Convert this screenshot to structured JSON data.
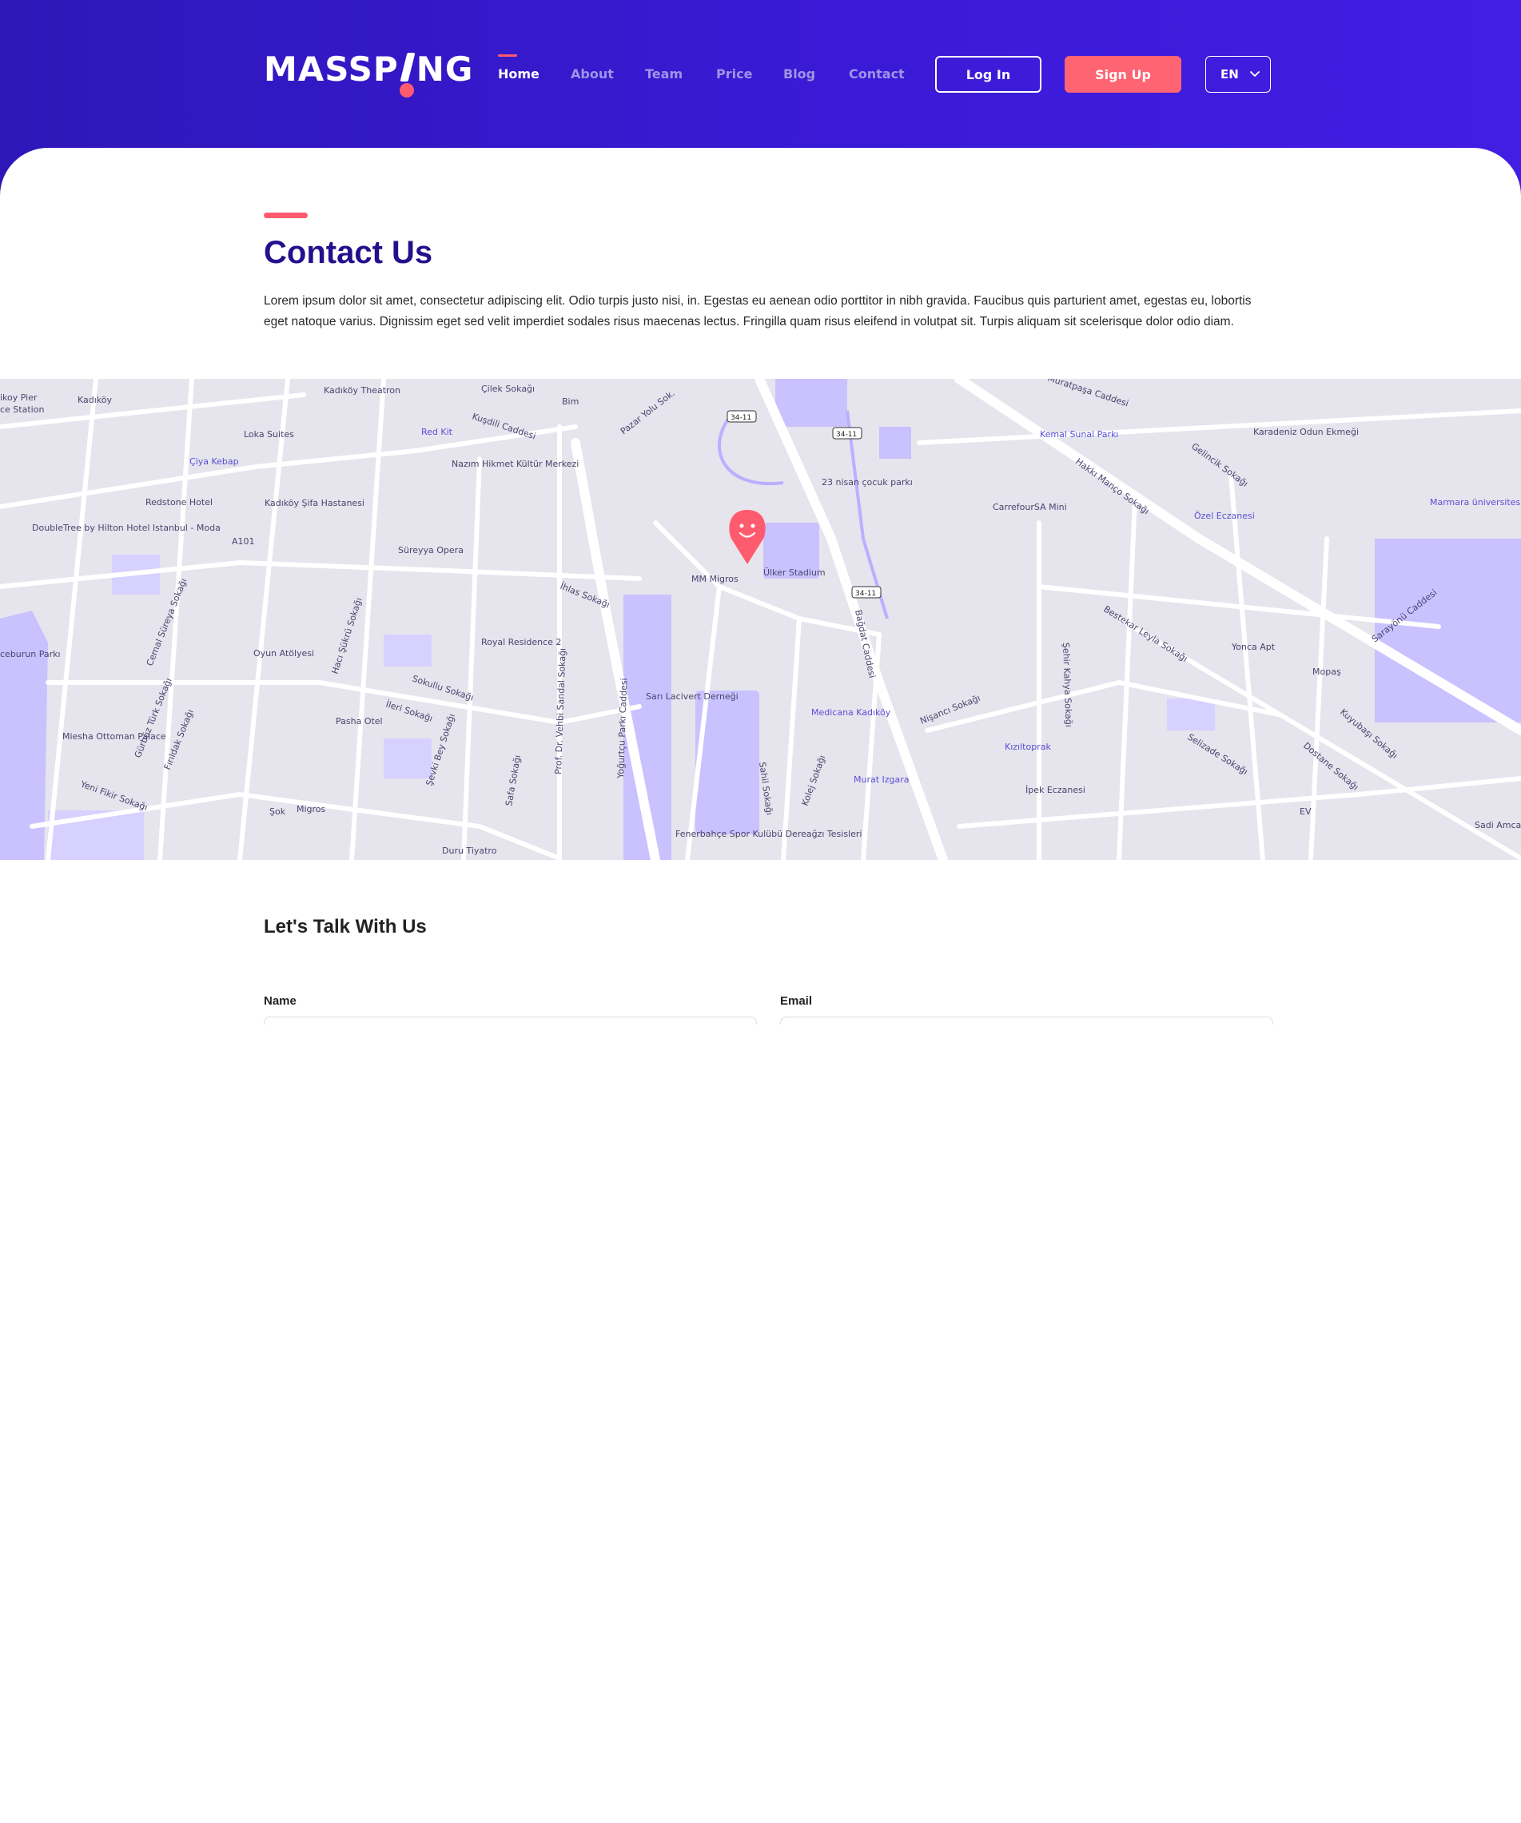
{
  "header": {
    "logo_text_left": "MASSP",
    "logo_text_right": "NG",
    "nav": [
      "Home",
      "About",
      "Team",
      "Price",
      "Blog",
      "Contact"
    ],
    "active_nav": "Home",
    "login_label": "Log In",
    "signup_label": "Sign Up",
    "language": "EN"
  },
  "page": {
    "title": "Contact Us",
    "intro": "Lorem ipsum dolor sit amet, consectetur adipiscing elit. Odio turpis justo nisi, in. Egestas eu aenean odio porttitor in nibh gravida. Faucibus quis parturient amet, egestas eu, lobortis eget natoque varius. Dignissim eget sed velit imperdiet sodales risus maecenas lectus. Fringilla quam risus eleifend in volutpat sit. Turpis aliquam sit scelerisque dolor odio diam."
  },
  "map": {
    "labels": {
      "ulker_stadium": "Ülker Stadium",
      "mm_migros": "MM Migros",
      "bagdat_caddesi": "Bağdat Caddesi",
      "kusdili_caddesi": "Kuşdili Caddesi",
      "kadikoy_theatron": "Kadıköy Theatron",
      "cilek_sokagi": "Çilek Sokağı",
      "bim": "Bim",
      "pazar_yolu": "Pazar Yolu Sok.",
      "red_kit": "Red Kit",
      "nazim_hikmet": "Nazım Hikmet Kültür Merkezi",
      "loka_suites": "Loka Suites",
      "ciya_kebap": "Çiya Kebap",
      "redstone_hotel": "Redstone Hotel",
      "kadikoy_sifa": "Kadıköy Şifa Hastanesi",
      "doubletree": "DoubleTree by Hilton Hotel Istanbul - Moda",
      "a101": "A101",
      "sureyya_opera": "Süreyya Opera",
      "ihlas_sokagi": "İhlas Sokağı",
      "royal_residence": "Royal Residence 2",
      "oyun_atolyesi": "Oyun Atölyesi",
      "sokullu_sokagi": "Sokullu Sokağı",
      "ileri_sokagi": "İleri Sokağı",
      "pasha_otel": "Pasha Otel",
      "sari_lacivert": "Sarı Lacivert Derneği",
      "medicana": "Medicana Kadıköy",
      "nisanci_sokagi": "Nişancı Sokağı",
      "kiziltoprak": "Kızıltoprak",
      "ipek_eczanesi": "İpek Eczanesi",
      "murat_izgara": "Murat Izgara",
      "fenerbahce_tesis": "Fenerbahçe Spor Kulübü Dereağzı Tesisleri",
      "sok": "Şok",
      "migros": "Migros",
      "duru_tiyatro": "Duru Tiyatro",
      "miesha_palace": "Miesha Ottoman Palace",
      "yeni_fikir": "Yeni Fikir Sokağı",
      "kemal_sunal": "Kemal Sunal Parkı",
      "karadeniz_ekmek": "Karadeniz Odun Ekmeği",
      "carrefour": "CarrefourSA Mini",
      "ozel_eczanesi": "Özel Eczanesi",
      "marmara_uni": "Marmara üniversitesi",
      "yonca_apt": "Yonca Apt",
      "mopas": "Mopaş",
      "sadi_amca": "Sadi Amca",
      "ev": "EV",
      "cocuk_parki": "23 nisan çocuk parkı",
      "road_3411": "34-11",
      "bestekar": "Bestekar Leyla Sokağı",
      "selizade": "Selizade Sokağı",
      "kuyubasi": "Kuyubaşı Sokağı",
      "dostane": "Dostane Sokağı",
      "sarayonu": "Sarayönü Caddesi",
      "hakki_manco": "Hakkı Manço Sokağı",
      "gelincik": "Gelincik Sokağı",
      "muratpasa": "Muratpaşa Caddesi",
      "sehir_kahya": "Şehir Kahya Sokağı",
      "yogurtcu": "Yoğurtçu Parkı Caddesi",
      "vehbi_sandal": "Prof. Dr. Vehbi Sandal Sokağı",
      "sahil_sokagi": "Sahil Sokağı",
      "kolej_sokagi": "Kolej Sokağı",
      "gurbuz_turk": "Gürbüz Türk Sokağı",
      "cemal_sureya": "Cemal Süreya Sokağı",
      "firildak": "Fırıldak Sokağı",
      "haci_sukru": "Hacı Şükrü Sokağı",
      "sevki_bey": "Şevki Bey Sokağı",
      "safa_sokagi": "Safa Sokağı",
      "kadikoy": "Kadıköy",
      "pier": "ikoy Pier",
      "ferry_station": "ce Station",
      "iceburun": "ceburun Parkı"
    },
    "colors": {
      "accent": "#ff5b6e",
      "poi": "#5b4fd6",
      "park": "#c9c2ff"
    }
  },
  "form": {
    "title": "Let's Talk With Us",
    "name_label": "Name",
    "email_label": "Email"
  },
  "colors": {
    "header_start": "#2e17b8",
    "header_end": "#421de3",
    "accent": "#ff5b6e",
    "title": "#24108c"
  }
}
